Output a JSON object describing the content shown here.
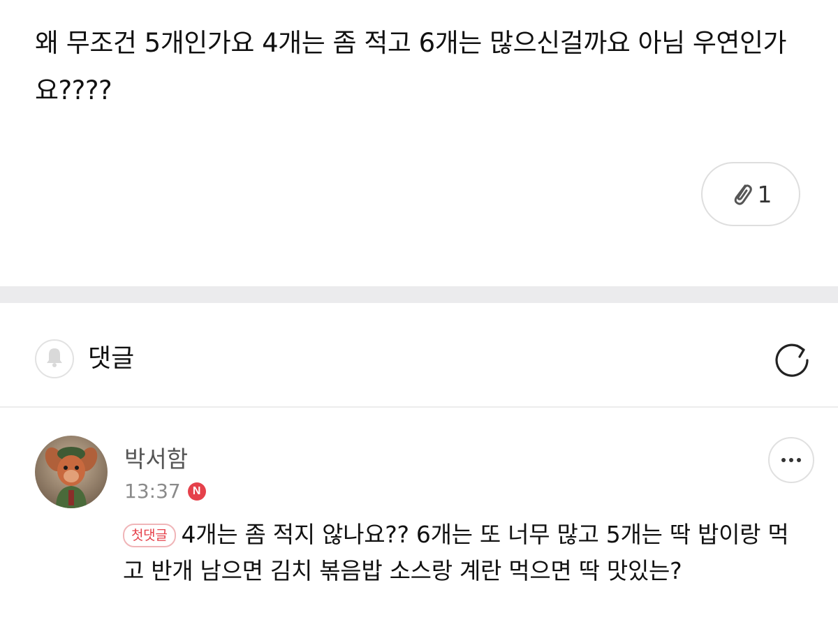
{
  "post": {
    "body": "왜 무조건 5개인가요 4개는 좀 적고 6개는 많으신걸까요 아님 우연인가요????",
    "attachment_count": "1",
    "attachment_icon": "paperclip-icon"
  },
  "comments_section": {
    "title": "댓글",
    "bell_icon": "bell-icon",
    "refresh_icon": "refresh-icon"
  },
  "comment": {
    "author": "박서함",
    "time": "13:37",
    "new_badge": "N",
    "first_comment_tag": "첫댓글",
    "text": "4개는 좀 적지 않나요?? 6개는 또 너무 많고 5개는 딱 밥이랑 먹고 반개 남으면 김치 볶음밥 소스랑 계란 먹으면 딱 맛있는?",
    "more_icon": "more-dots-icon"
  },
  "colors": {
    "accent_red": "#e5414b",
    "divider_gray": "#ebebed",
    "text_primary": "#111111",
    "text_secondary": "#8a8a8a"
  }
}
